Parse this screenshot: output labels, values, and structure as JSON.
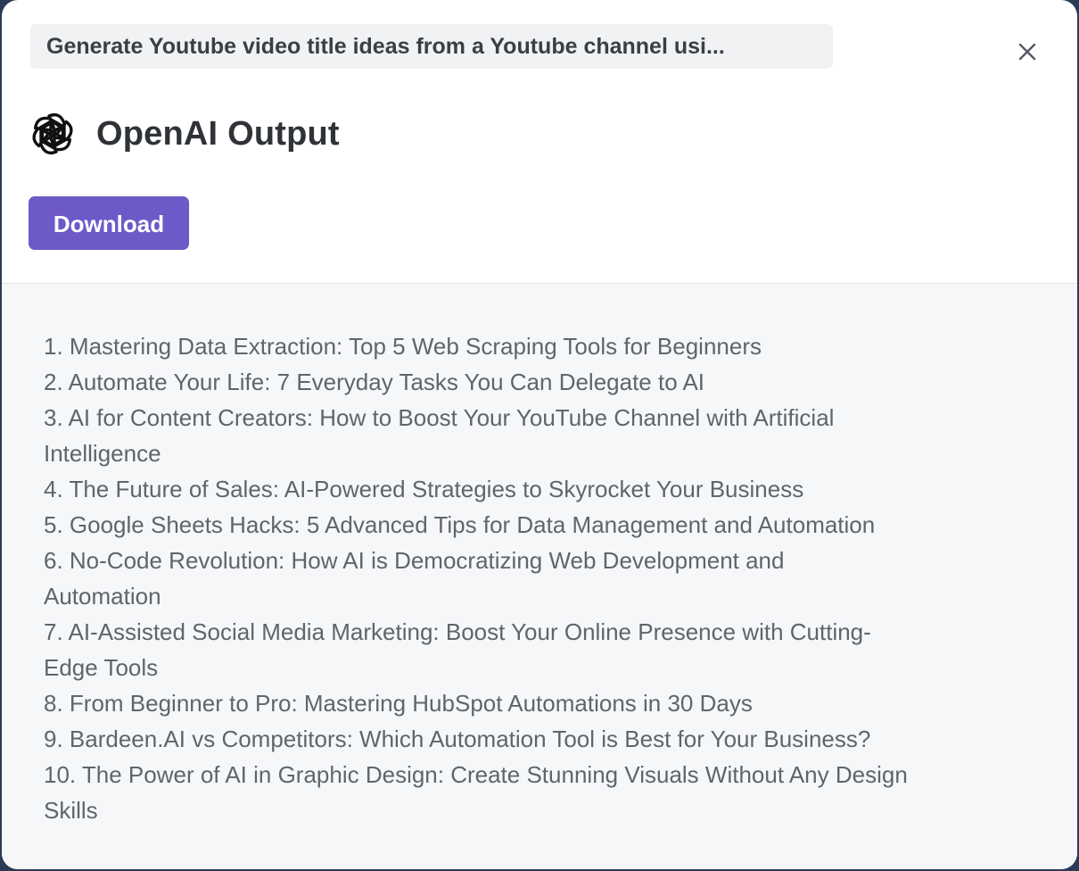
{
  "header": {
    "prompt_title": "Generate Youtube video title ideas from a Youtube channel usi...",
    "title": "OpenAI Output",
    "download_label": "Download",
    "close_icon": "close-icon",
    "logo_icon": "openai-logo-icon"
  },
  "colors": {
    "accent": "#6e59c9",
    "body_bg": "#f6f7f9"
  },
  "output": {
    "lines": [
      "1. Mastering Data Extraction: Top 5 Web Scraping Tools for Beginners",
      "2. Automate Your Life: 7 Everyday Tasks You Can Delegate to AI",
      "3. AI for Content Creators: How to Boost Your YouTube Channel with Artificial",
      "Intelligence",
      "4. The Future of Sales: AI-Powered Strategies to Skyrocket Your Business",
      "5. Google Sheets Hacks: 5 Advanced Tips for Data Management and Automation",
      "6. No-Code Revolution: How AI is Democratizing Web Development and",
      "Automation",
      "7. AI-Assisted Social Media Marketing: Boost Your Online Presence with Cutting-",
      "Edge Tools",
      "8. From Beginner to Pro: Mastering HubSpot Automations in 30 Days",
      "9. Bardeen.AI vs Competitors: Which Automation Tool is Best for Your Business?",
      "10. The Power of AI in Graphic Design: Create Stunning Visuals Without Any Design",
      "Skills"
    ]
  }
}
